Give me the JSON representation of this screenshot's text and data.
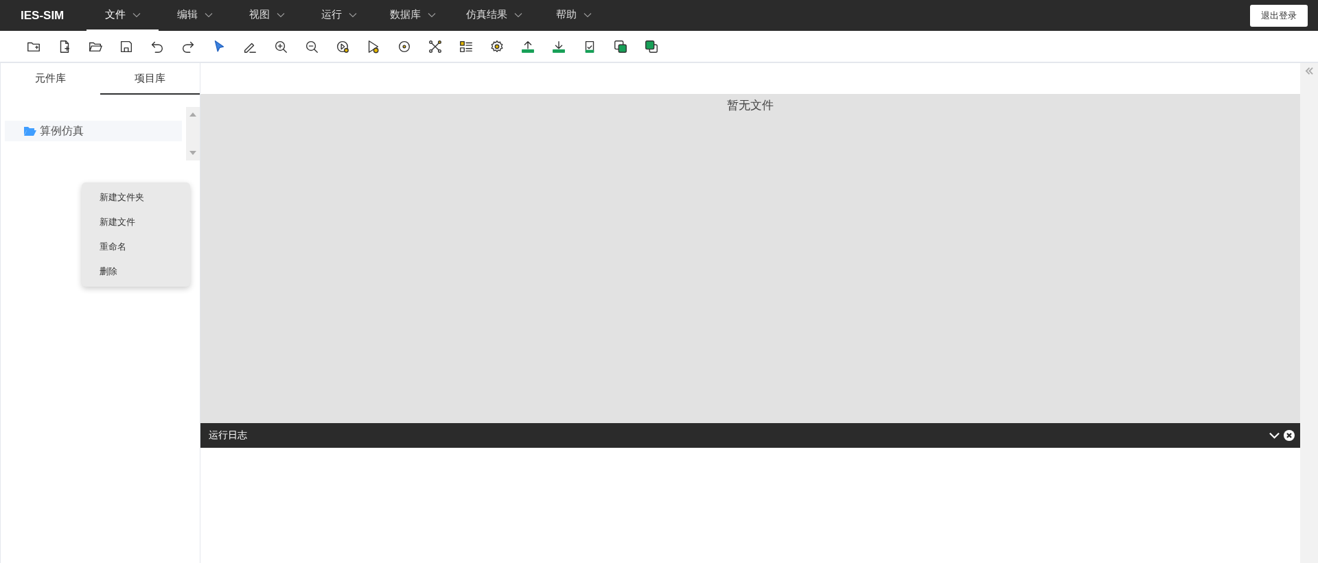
{
  "header": {
    "logo": "IES-SIM",
    "menus": [
      {
        "label": "文件",
        "selected": true
      },
      {
        "label": "编辑",
        "selected": false
      },
      {
        "label": "视图",
        "selected": false
      },
      {
        "label": "运行",
        "selected": false
      },
      {
        "label": "数据库",
        "selected": false
      },
      {
        "label": "仿真结果",
        "selected": false
      },
      {
        "label": "帮助",
        "selected": false
      }
    ],
    "logout": "退出登录"
  },
  "sidebar": {
    "tabs": [
      {
        "label": "元件库",
        "selected": false
      },
      {
        "label": "项目库",
        "selected": true
      }
    ],
    "tree": [
      {
        "label": "算例仿真",
        "expanded": true
      }
    ],
    "context_menu": [
      "新建文件夹",
      "新建文件",
      "重命名",
      "删除"
    ]
  },
  "canvas": {
    "empty_message": "暂无文件"
  },
  "log_panel": {
    "title": "运行日志"
  }
}
